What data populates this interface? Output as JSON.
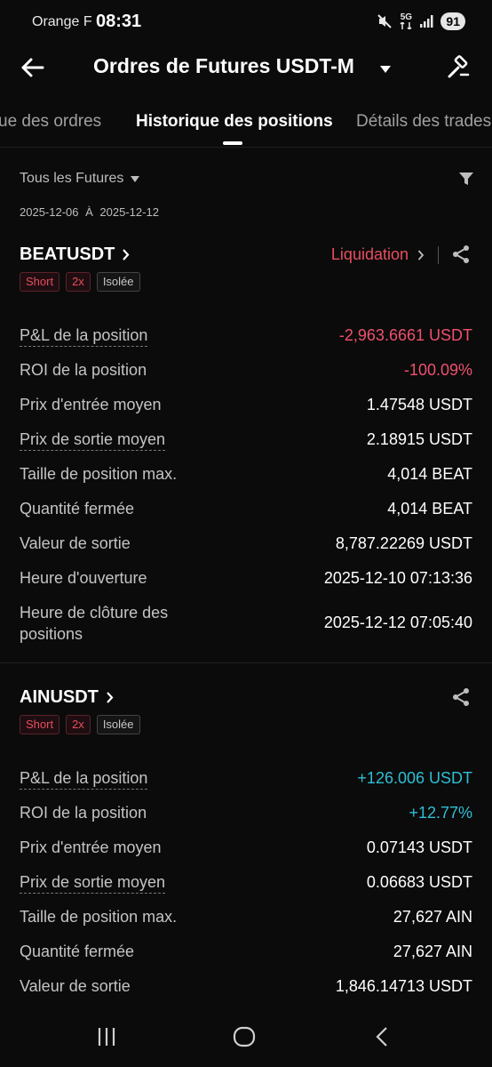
{
  "status_bar": {
    "carrier": "Orange F",
    "time": "08:31",
    "network": "5G",
    "battery": "91"
  },
  "header": {
    "title": "Ordres de Futures USDT-M"
  },
  "tabs": [
    {
      "label": "ue des ordres"
    },
    {
      "label": "Historique des positions"
    },
    {
      "label": "Détails des trades"
    }
  ],
  "filters": {
    "market": "Tous les Futures",
    "date_from": "2025-12-06",
    "date_sep": "À",
    "date_to": "2025-12-12"
  },
  "positions": [
    {
      "symbol": "BEATUSDT",
      "side": "Short",
      "leverage": "2x",
      "margin": "Isolée",
      "status": "Liquidation",
      "rows": [
        {
          "label": "P&L de la position",
          "value": "-2,963.6661 USDT"
        },
        {
          "label": "ROI de la position",
          "value": "-100.09%"
        },
        {
          "label": "Prix d'entrée moyen",
          "value": "1.47548 USDT"
        },
        {
          "label": "Prix de sortie moyen",
          "value": "2.18915 USDT"
        },
        {
          "label": "Taille de position max.",
          "value": "4,014 BEAT"
        },
        {
          "label": "Quantité fermée",
          "value": "4,014 BEAT"
        },
        {
          "label": "Valeur de sortie",
          "value": "8,787.22269 USDT"
        },
        {
          "label": "Heure d'ouverture",
          "value": "2025-12-10 07:13:36"
        },
        {
          "label": "Heure de clôture des",
          "label2": "positions",
          "value": "2025-12-12 07:05:40"
        }
      ]
    },
    {
      "symbol": "AINUSDT",
      "side": "Short",
      "leverage": "2x",
      "margin": "Isolée",
      "rows": [
        {
          "label": "P&L de la position",
          "value": "+126.006 USDT"
        },
        {
          "label": "ROI de la position",
          "value": "+12.77%"
        },
        {
          "label": "Prix d'entrée moyen",
          "value": "0.07143 USDT"
        },
        {
          "label": "Prix de sortie moyen",
          "value": "0.06683 USDT"
        },
        {
          "label": "Taille de position max.",
          "value": "27,627 AIN"
        },
        {
          "label": "Quantité fermée",
          "value": "27,627 AIN"
        },
        {
          "label": "Valeur de sortie",
          "value": "1,846.14713 USDT"
        }
      ]
    }
  ],
  "colors": {
    "loss": "#f0506e",
    "profit": "#2ebfd6",
    "background": "#0b0b0b"
  }
}
